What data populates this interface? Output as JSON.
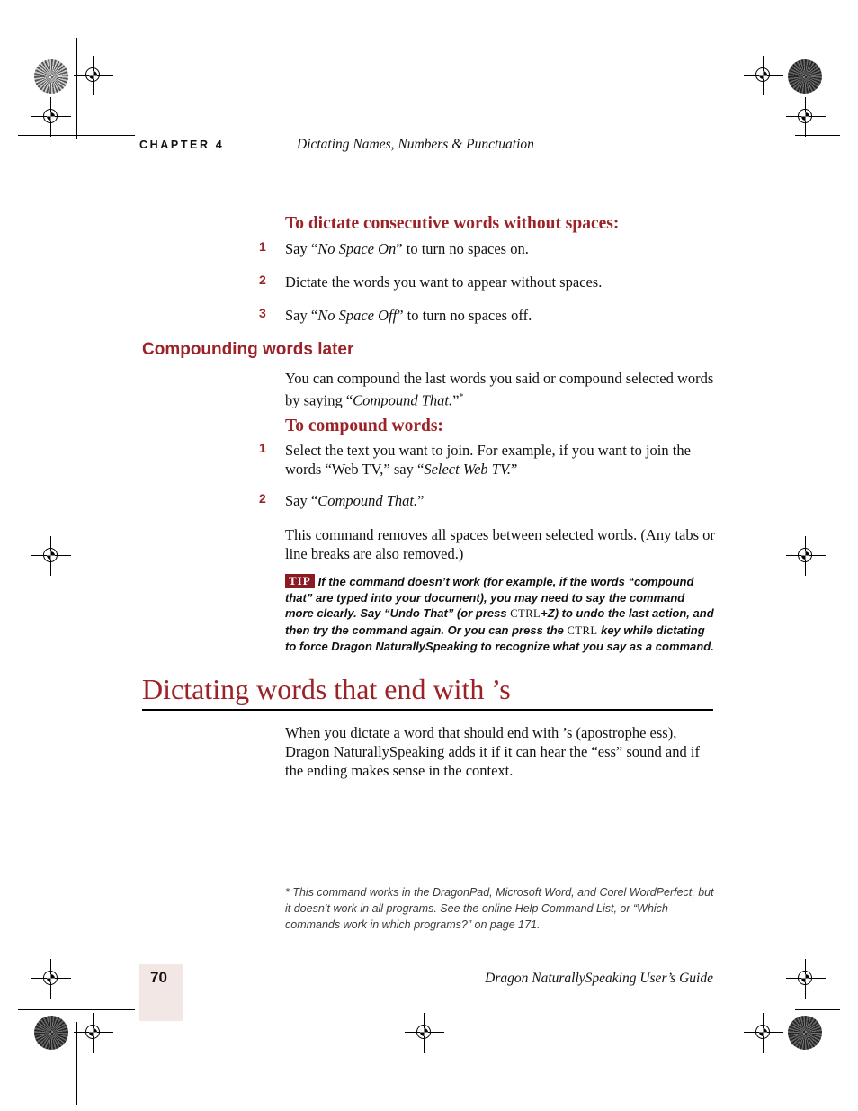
{
  "header": {
    "chapter_label": "CHAPTER 4",
    "running_title": "Dictating Names, Numbers & Punctuation"
  },
  "sections": {
    "no_space_heading": "To dictate consecutive words without spaces:",
    "no_space_steps": [
      {
        "num": "1",
        "html": "Say “<em class=\"cmd\">No Space On</em>” to turn no spaces on."
      },
      {
        "num": "2",
        "html": "Dictate the words you want to appear without spaces."
      },
      {
        "num": "3",
        "html": "Say “<em class=\"cmd\">No Space Off</em>” to turn no spaces off."
      }
    ],
    "compounding_heading": "Compounding words later",
    "compounding_intro": "You can compound the last words you said or compound selected words by saying “<em class=\"cmd\">Compound That.</em>”<sup class=\"fn\">*</sup>",
    "compound_heading": "To compound words:",
    "compound_steps": [
      {
        "num": "1",
        "html": "Select the text you want to join. For example, if you want to join the words “Web TV,” say “<em class=\"cmd\">Select Web TV.</em>”"
      },
      {
        "num": "2",
        "html": "Say “<em class=\"cmd\">Compound That.</em>”"
      }
    ],
    "compound_note": "This command removes all spaces between selected words. (Any tabs or line breaks are also removed.)",
    "tip_badge": "TIP",
    "tip_html": "If the command doesn’t work (for example, if the words “compound that” are typed into your document), you may need to say the command more clearly. Say “Undo That” (or press <span class=\"key\">CTRL</span>+Z) to undo the last action, and then try the command again. Or you can press the <span class=\"key\">CTRL</span> key while dictating to force Dragon NaturallySpeaking to recognize what you say as a command.",
    "apostrophe_s_heading": "Dictating words that end with ’s",
    "apostrophe_s_body": "When you dictate a word that should end with ’s (apostrophe ess), Dragon NaturallySpeaking adds it if it can hear the “ess” sound and if the ending makes sense in the context."
  },
  "footnote": {
    "text": "* This command works in the DragonPad, Microsoft Word, and Corel WordPerfect, but it doesn’t work in all programs. See the online Help Command List, or “Which commands work in which programs?” on page 171."
  },
  "footer": {
    "page_number": "70",
    "guide_title": "Dragon NaturallySpeaking User’s Guide"
  },
  "colors": {
    "heading_red": "#9b2226",
    "tip_badge_red": "#8c1a22",
    "page_tint": "#f3e7e5"
  }
}
